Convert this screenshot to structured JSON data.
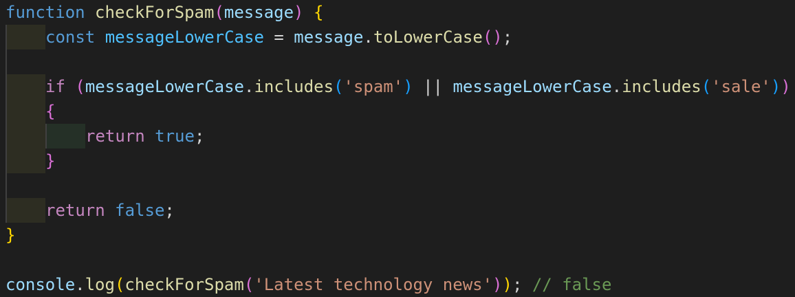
{
  "code": {
    "line1": {
      "kw": "function",
      "name": "checkForSpam",
      "open": "(",
      "param": "message",
      "close": ")",
      "brace": "{"
    },
    "line2": {
      "kw": "const",
      "var": "messageLowerCase",
      "eq": "=",
      "obj": "message",
      "dot": ".",
      "method": "toLowerCase",
      "parens": "()",
      "semi": ";"
    },
    "line4": {
      "kw": "if",
      "open": "(",
      "var1": "messageLowerCase",
      "dot1": ".",
      "method1": "includes",
      "p1open": "(",
      "str1": "'spam'",
      "p1close": ")",
      "or": "||",
      "var2": "messageLowerCase",
      "dot2": ".",
      "method2": "includes",
      "p2open": "(",
      "str2": "'sale'",
      "p2close": ")",
      "close": ")"
    },
    "line5": {
      "brace": "{"
    },
    "line6": {
      "kw": "return",
      "val": "true",
      "semi": ";"
    },
    "line7": {
      "brace": "}"
    },
    "line9": {
      "kw": "return",
      "val": "false",
      "semi": ";"
    },
    "line10": {
      "brace": "}"
    },
    "line12": {
      "obj": "console",
      "dot": ".",
      "method": "log",
      "open1": "(",
      "fn": "checkForSpam",
      "open2": "(",
      "str": "'Latest technology news'",
      "close2": ")",
      "close1": ")",
      "semi": ";",
      "comment": "// false"
    }
  },
  "colors": {
    "background": "#1e1e1e",
    "keyword": "#569cd6",
    "control": "#c586c0",
    "function": "#dcdcaa",
    "variable": "#9cdcfe",
    "string": "#ce9178",
    "comment": "#6a9955"
  }
}
